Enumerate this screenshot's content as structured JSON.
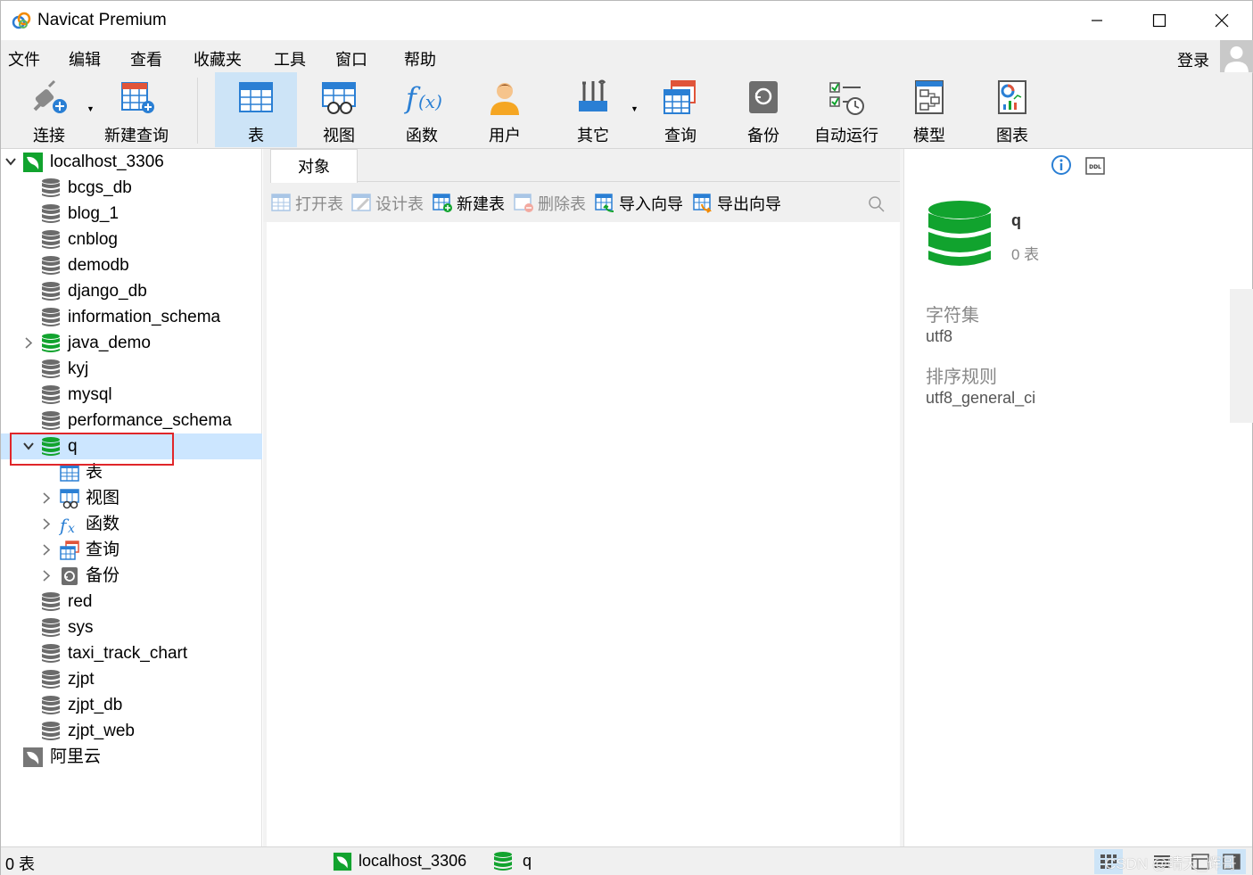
{
  "window": {
    "title": "Navicat Premium",
    "controls": [
      "minimize",
      "maximize",
      "close"
    ]
  },
  "menubar": {
    "items": [
      "文件",
      "编辑",
      "查看",
      "收藏夹",
      "工具",
      "窗口",
      "帮助"
    ],
    "login": "登录"
  },
  "toolbar": {
    "items": [
      {
        "label": "连接",
        "icon": "connection-plug-icon"
      },
      {
        "label": "新建查询",
        "icon": "new-query-icon"
      },
      {
        "label": "表",
        "icon": "table-icon",
        "active": true
      },
      {
        "label": "视图",
        "icon": "view-icon"
      },
      {
        "label": "函数",
        "icon": "function-icon"
      },
      {
        "label": "用户",
        "icon": "user-icon"
      },
      {
        "label": "其它",
        "icon": "tools-icon"
      },
      {
        "label": "查询",
        "icon": "query-icon"
      },
      {
        "label": "备份",
        "icon": "backup-icon"
      },
      {
        "label": "自动运行",
        "icon": "automation-icon"
      },
      {
        "label": "模型",
        "icon": "model-icon"
      },
      {
        "label": "图表",
        "icon": "chart-icon"
      }
    ]
  },
  "tree": {
    "connection": "localhost_3306",
    "databases": [
      "bcgs_db",
      "blog_1",
      "cnblog",
      "demodb",
      "django_db",
      "information_schema",
      "java_demo",
      "kyj",
      "mysql",
      "performance_schema",
      "q",
      "red",
      "sys",
      "taxi_track_chart",
      "zjpt",
      "zjpt_db",
      "zjpt_web"
    ],
    "selected": "q",
    "children": [
      "表",
      "视图",
      "函数",
      "查询",
      "备份"
    ],
    "other_connection": "阿里云"
  },
  "objects": {
    "tab": "对象",
    "actions": [
      {
        "label": "打开表",
        "enabled": false
      },
      {
        "label": "设计表",
        "enabled": false
      },
      {
        "label": "新建表",
        "enabled": true
      },
      {
        "label": "删除表",
        "enabled": false
      },
      {
        "label": "导入向导",
        "enabled": true
      },
      {
        "label": "导出向导",
        "enabled": true
      }
    ]
  },
  "info": {
    "name": "q",
    "count": "0 表",
    "charset_label": "字符集",
    "charset": "utf8",
    "collation_label": "排序规则",
    "collation": "utf8_general_ci"
  },
  "status": {
    "left": "0 表",
    "connection": "localhost_3306",
    "database": "q",
    "watermark": "CSDN @晴天_辉哥"
  },
  "colors": {
    "selected": "#cce6ff",
    "active_tool": "#cde4f7",
    "green_db": "#11a32e",
    "gray_db": "#6b6b6b",
    "highlight_box": "#e0262a"
  }
}
